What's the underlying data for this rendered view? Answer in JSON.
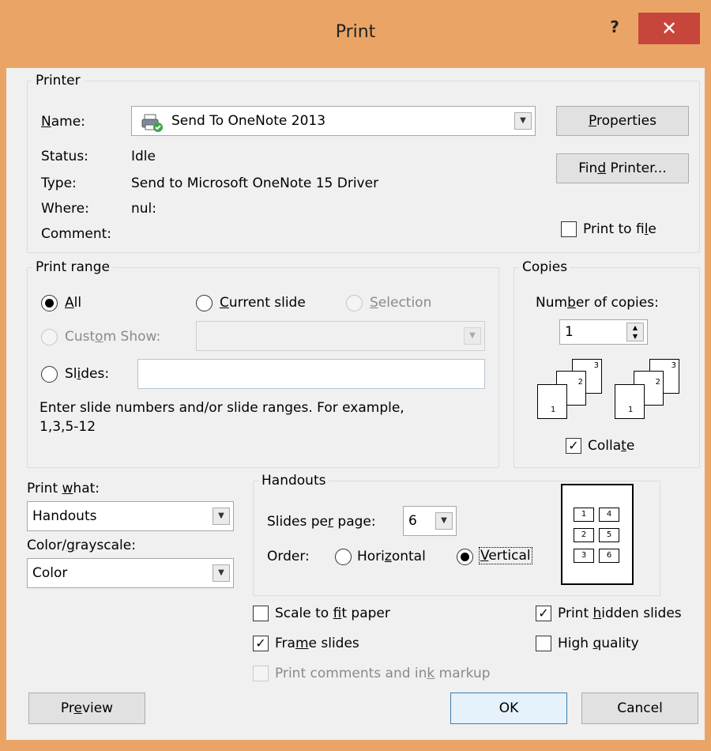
{
  "dialog": {
    "title": "Print",
    "help": "?",
    "close": "✕"
  },
  "printer": {
    "group_label": "Printer",
    "name_label": "Name:",
    "name_value": "Send To OneNote 2013",
    "status_label": "Status:",
    "status_value": "Idle",
    "type_label": "Type:",
    "type_value": "Send to Microsoft OneNote 15 Driver",
    "where_label": "Where:",
    "where_value": "nul:",
    "comment_label": "Comment:",
    "properties_button": "Properties",
    "find_printer_button": "Find Printer...",
    "print_to_file_label": "Print to file",
    "print_to_file_checked": false
  },
  "print_range": {
    "group_label": "Print range",
    "all_label": "All",
    "current_slide_label": "Current slide",
    "selection_label": "Selection",
    "custom_show_label": "Custom Show:",
    "slides_label": "Slides:",
    "slides_value": "",
    "hint": "Enter slide numbers and/or slide ranges. For example,",
    "hint_example": "1,3,5-12",
    "selected": "All"
  },
  "copies": {
    "group_label": "Copies",
    "number_label": "Number of copies:",
    "number_value": "1",
    "collate_label": "Collate",
    "collate_checked": true,
    "stack_pages": [
      "1",
      "2",
      "3"
    ]
  },
  "print_what": {
    "label": "Print what:",
    "value": "Handouts",
    "color_label": "Color/grayscale:",
    "color_value": "Color"
  },
  "handouts": {
    "group_label": "Handouts",
    "slides_per_page_label": "Slides per page:",
    "slides_per_page_value": "6",
    "order_label": "Order:",
    "horizontal_label": "Horizontal",
    "vertical_label": "Vertical",
    "order_selected": "Vertical",
    "preview_numbers": [
      "1",
      "4",
      "2",
      "5",
      "3",
      "6"
    ]
  },
  "options": {
    "scale_to_fit": {
      "label": "Scale to fit paper",
      "checked": false
    },
    "frame_slides": {
      "label": "Frame slides",
      "checked": true
    },
    "print_comments": {
      "label": "Print comments and ink markup",
      "checked": false
    },
    "print_hidden": {
      "label": "Print hidden slides",
      "checked": true
    },
    "high_quality": {
      "label": "High quality",
      "checked": false
    }
  },
  "buttons": {
    "preview": "Preview",
    "ok": "OK",
    "cancel": "Cancel"
  },
  "colors": {
    "title_bar": "#eaa566",
    "close_button": "#c7463b",
    "dialog_bg": "#f0f0f0"
  }
}
